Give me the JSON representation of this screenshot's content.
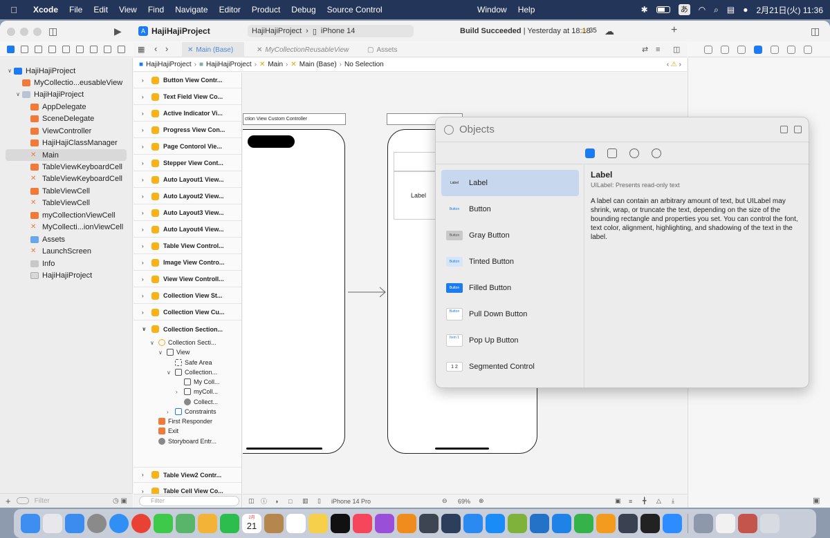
{
  "menubar": {
    "app": "Xcode",
    "menus": [
      "File",
      "Edit",
      "View",
      "Find",
      "Navigate",
      "Editor",
      "Product",
      "Debug",
      "Source Control"
    ],
    "right_menus": [
      "Window",
      "Help"
    ],
    "ime": "あ",
    "clock": "2月21日(火) 11:36"
  },
  "toolbar": {
    "project_title": "HajiHajiProject",
    "scheme": "HajiHajiProject",
    "device": "iPhone 14",
    "build_status_bold": "Build Succeeded",
    "build_status_rest": " | Yesterday at 18:18",
    "warnings": "35",
    "add": "+"
  },
  "tabs": [
    {
      "label": "Main (Base)"
    },
    {
      "label": "MyCollectionReusableView"
    },
    {
      "label": "Assets"
    }
  ],
  "breadcrumb": [
    "HajiHajiProject",
    "HajiHajiProject",
    "Main",
    "Main (Base)",
    "No Selection"
  ],
  "navigator": {
    "items": [
      {
        "label": "HajiHajiProject"
      },
      {
        "label": "MyCollectio...eusableView"
      },
      {
        "label": "HajiHajiProject"
      },
      {
        "label": "AppDelegate"
      },
      {
        "label": "SceneDelegate"
      },
      {
        "label": "ViewController"
      },
      {
        "label": "HajiHajiClassManager"
      },
      {
        "label": "Main"
      },
      {
        "label": "TableViewKeyboardCell"
      },
      {
        "label": "TableViewKeyboardCell"
      },
      {
        "label": "TableViewCell"
      },
      {
        "label": "TableViewCell"
      },
      {
        "label": "myCollectionViewCell"
      },
      {
        "label": "MyCollecti...ionViewCell"
      },
      {
        "label": "Assets"
      },
      {
        "label": "LaunchScreen"
      },
      {
        "label": "Info"
      },
      {
        "label": "HajiHajiProject"
      }
    ],
    "filter_placeholder": "Filter"
  },
  "outline": {
    "scenes": [
      {
        "label": "Button View Contr..."
      },
      {
        "label": "Text Field View Co..."
      },
      {
        "label": "Active Indicator Vi..."
      },
      {
        "label": "Progress View Con..."
      },
      {
        "label": "Page Contorol Vie..."
      },
      {
        "label": "Stepper View Cont..."
      },
      {
        "label": "Auto Layout1 View..."
      },
      {
        "label": "Auto Layout2 View..."
      },
      {
        "label": "Auto Layout3 View..."
      },
      {
        "label": "Auto Layout4 View..."
      },
      {
        "label": "Table View Control..."
      },
      {
        "label": "Image View Contro..."
      },
      {
        "label": "View View Controll..."
      },
      {
        "label": "Collection View St..."
      },
      {
        "label": "Collection View Cu..."
      },
      {
        "label": "Collection Section..."
      }
    ],
    "children": [
      {
        "label": "Collection Secti..."
      },
      {
        "label": "View"
      },
      {
        "label": "Safe Area"
      },
      {
        "label": "Collection..."
      },
      {
        "label": "My Coll..."
      },
      {
        "label": "myColl..."
      },
      {
        "label": "Collect..."
      },
      {
        "label": "Constraints"
      },
      {
        "label": "First Responder"
      },
      {
        "label": "Exit"
      },
      {
        "label": "Storyboard Entr..."
      }
    ],
    "after": [
      {
        "label": "Table View2 Contr..."
      },
      {
        "label": "Table Cell View Co..."
      }
    ],
    "filter_placeholder": "Filter"
  },
  "canvas": {
    "scene1_title": "ction View Custom Controller",
    "scene2_label": "Label",
    "device_label": "iPhone 14 Pro",
    "zoom": "69%"
  },
  "library": {
    "search_placeholder": "Objects",
    "items": [
      {
        "label": "Label",
        "thumb": "Label"
      },
      {
        "label": "Button",
        "thumb": "Button"
      },
      {
        "label": "Gray Button",
        "thumb": "Button"
      },
      {
        "label": "Tinted Button",
        "thumb": "Button"
      },
      {
        "label": "Filled Button",
        "thumb": "Button"
      },
      {
        "label": "Pull Down Button",
        "thumb": "Button"
      },
      {
        "label": "Pop Up Button",
        "thumb": "Item 1"
      },
      {
        "label": "Segmented Control",
        "thumb": "1  2"
      }
    ],
    "detail": {
      "title": "Label",
      "subtitle": "UILabel: Presents read-only text",
      "description": "A label can contain an arbitrary amount of text, but UILabel may shrink, wrap, or truncate the text, depending on the size of the bounding rectangle and properties you set. You can control the font, text color, alignment, highlighting, and shadowing of the text in the label."
    }
  },
  "dock": {
    "calendar_month": "2月",
    "calendar_day": "21"
  },
  "colors": {
    "accent": "#1d7bf2",
    "swift": "#f07a3a",
    "warning": "#e8a400",
    "menubar": "#24355a"
  }
}
